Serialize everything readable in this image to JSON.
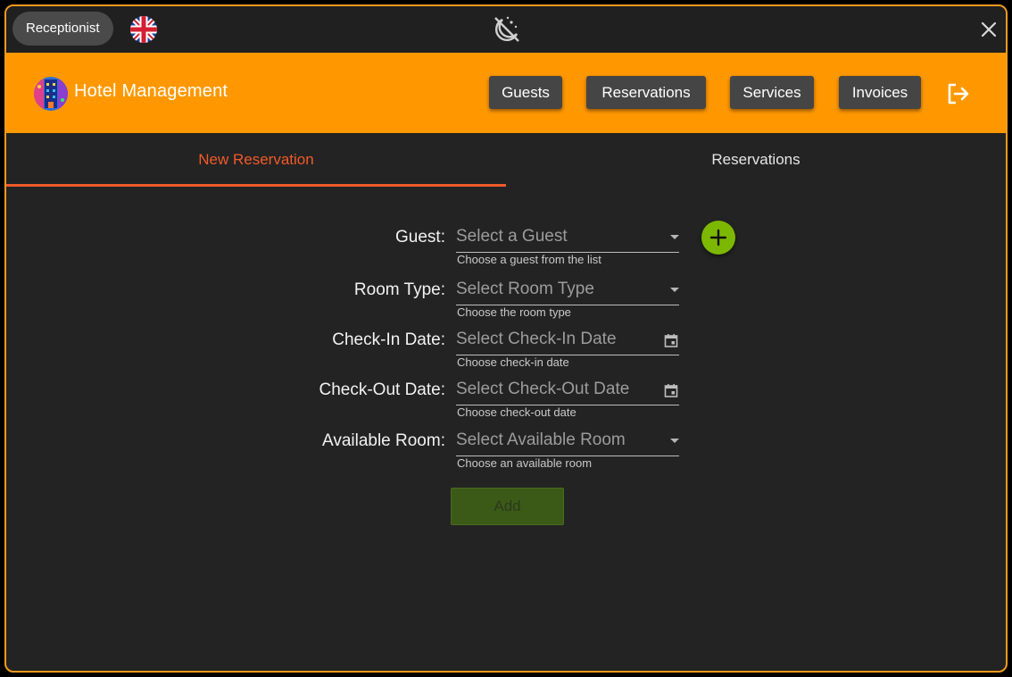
{
  "titlebar": {
    "role": "Receptionist",
    "language_icon": "uk-flag-icon",
    "theme_icon": "theme-toggle-icon",
    "close_icon": "close-icon"
  },
  "header": {
    "app_title": "Hotel Management",
    "nav": [
      {
        "label": "Guests"
      },
      {
        "label": "Reservations"
      },
      {
        "label": "Services"
      },
      {
        "label": "Invoices"
      }
    ],
    "logout_icon": "logout-icon"
  },
  "tabs": {
    "new_reservation": "New Reservation",
    "reservations": "Reservations",
    "active": "New Reservation"
  },
  "form": {
    "guest": {
      "label": "Guest:",
      "placeholder": "Select a Guest",
      "hint": "Choose a guest from the list"
    },
    "room_type": {
      "label": "Room Type:",
      "placeholder": "Select Room Type",
      "hint": "Choose the room type"
    },
    "check_in": {
      "label": "Check-In Date:",
      "placeholder": "Select Check-In Date",
      "hint": "Choose check-in date"
    },
    "check_out": {
      "label": "Check-Out Date:",
      "placeholder": "Select Check-Out Date",
      "hint": "Choose check-out date"
    },
    "available_room": {
      "label": "Available Room:",
      "placeholder": "Select Available Room",
      "hint": "Choose an available room"
    },
    "add_label": "Add"
  },
  "colors": {
    "accent": "#ff9800",
    "active_tab": "#ef5b2a",
    "add_guest": "#7cb800",
    "background": "#232323"
  }
}
